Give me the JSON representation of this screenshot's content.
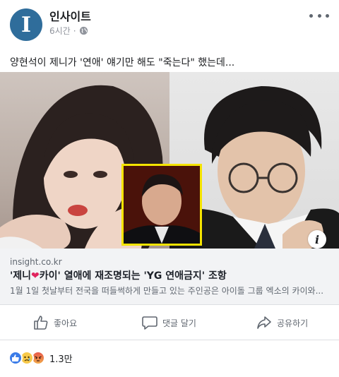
{
  "post": {
    "page_name": "인사이트",
    "time": "6시간",
    "separator": "·",
    "privacy_icon": "globe-icon",
    "more_icon": "more-horizontal-icon",
    "text": "양현석이 제니가 '연애' 얘기만 해도 \"죽는다\" 했는데..."
  },
  "link": {
    "domain": "insight.co.kr",
    "title_part1": "'제니",
    "title_heart": "❤",
    "title_part2": "카이' 열애에 재조명되는 'YG 연애금지' 조항",
    "description": "1월 1일 첫날부터 전국을 떠들썩하게 만들고 있는 주인공은 아이돌 그룹 엑소의 카이와...",
    "info_icon": "i"
  },
  "actions": {
    "like_label": "좋아요",
    "comment_label": "댓글 달기",
    "share_label": "공유하기"
  },
  "reactions": {
    "count": "1.3만",
    "types": [
      "like",
      "sad",
      "angry"
    ]
  },
  "colors": {
    "avatar_bg": "#2f6d9b",
    "inset_border": "#f5e400",
    "link_body_bg": "#f2f3f5",
    "like_reaction": "#3b7ce8"
  }
}
